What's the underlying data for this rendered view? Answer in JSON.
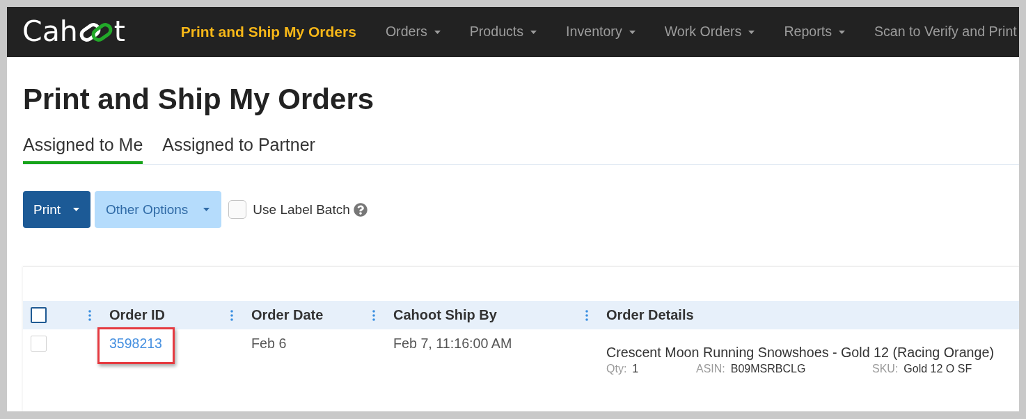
{
  "navbar": {
    "logo": {
      "lead": "Cah",
      "tail": "t"
    },
    "items": [
      {
        "label": "Print and Ship My Orders",
        "selected": true,
        "dropdown": false
      },
      {
        "label": "Orders",
        "selected": false,
        "dropdown": true
      },
      {
        "label": "Products",
        "selected": false,
        "dropdown": true
      },
      {
        "label": "Inventory",
        "selected": false,
        "dropdown": true
      },
      {
        "label": "Work Orders",
        "selected": false,
        "dropdown": true
      },
      {
        "label": "Reports",
        "selected": false,
        "dropdown": true
      },
      {
        "label": "Scan to Verify and Print",
        "selected": false,
        "dropdown": false
      }
    ]
  },
  "page": {
    "title": "Print and Ship My Orders"
  },
  "tabs": [
    {
      "label": "Assigned to Me",
      "selected": true
    },
    {
      "label": "Assigned to Partner",
      "selected": false
    }
  ],
  "toolbar": {
    "buttons": [
      {
        "label": "Print",
        "kind": "primary"
      },
      {
        "label": "Other Options",
        "kind": "secondary"
      }
    ],
    "label_batch": {
      "label": "Use Label Batch",
      "checked": false
    }
  },
  "table": {
    "select_all_checked": false,
    "columns": [
      "Order ID",
      "Order Date",
      "Cahoot Ship By",
      "Order Details"
    ],
    "rows": [
      {
        "checked": false,
        "order_id": "3598213",
        "order_id_highlighted": true,
        "order_date": "Feb 6",
        "ship_by": "Feb 7, 11:16:00 AM",
        "details": {
          "title": "Crescent Moon Running Snowshoes - Gold 12 (Racing Orange)",
          "fields": [
            {
              "label": "Qty:",
              "value": "1"
            },
            {
              "label": "ASIN:",
              "value": "B09MSRBCLG"
            },
            {
              "label": "SKU:",
              "value": "Gold 12 O SF"
            }
          ]
        }
      }
    ]
  }
}
